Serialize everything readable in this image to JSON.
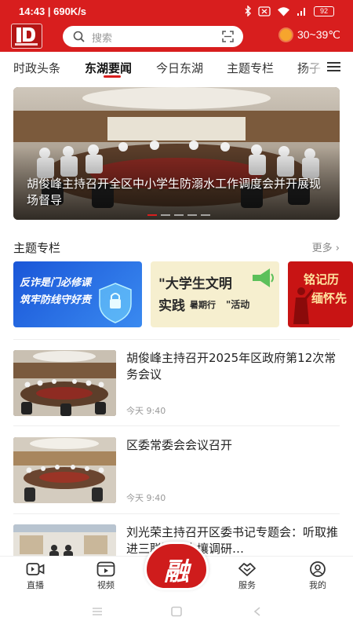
{
  "status_bar": {
    "time_speed": "14:43 | 690K/s",
    "battery": "92"
  },
  "header": {
    "logo_name": "fused-media-logo",
    "search_placeholder": "搜索",
    "weather": "30~39℃",
    "accent_color": "#d81e1e"
  },
  "tabs": [
    {
      "label": "时政头条",
      "active": false
    },
    {
      "label": "东湖要闻",
      "active": true
    },
    {
      "label": "今日东湖",
      "active": false
    },
    {
      "label": "主题专栏",
      "active": false
    },
    {
      "label": "扬子",
      "active": false
    }
  ],
  "banner": {
    "caption": "胡俊峰主持召开全区中小学生防溺水工作调度会并开展现场督导",
    "slide_count": 5,
    "active_slide": 1
  },
  "topics": {
    "title": "主题专栏",
    "more": "更多",
    "cards": [
      {
        "line1": "反诈是门必修课",
        "line2": "筑牢防线守好责"
      },
      {
        "line1": "\"大学生文明",
        "line2": "实践",
        "line3": "暑期行",
        "line4": "\"活动"
      },
      {
        "line1": "铭记历",
        "line2": "缅怀先"
      }
    ]
  },
  "news": [
    {
      "title": "胡俊峰主持召开2025年区政府第12次常务会议",
      "time": "今天 9:40"
    },
    {
      "title": "区委常委会会议召开",
      "time": "今天 9:40"
    },
    {
      "title": "刘光荣主持召开区委书记专题会：听取推进三联滩头土壤调研…",
      "time": ""
    }
  ],
  "bottom_nav": [
    {
      "label": "直播",
      "icon": "live-camera-icon"
    },
    {
      "label": "视频",
      "icon": "video-play-icon"
    },
    {
      "label": "服务",
      "icon": "handshake-icon"
    },
    {
      "label": "我的",
      "icon": "user-icon"
    }
  ],
  "center_button": {
    "label": "融"
  }
}
